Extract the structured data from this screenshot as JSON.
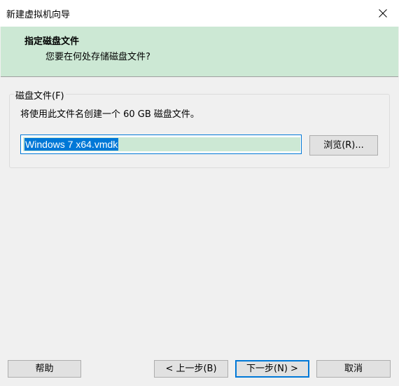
{
  "window": {
    "title": "新建虚拟机向导"
  },
  "header": {
    "title": "指定磁盘文件",
    "subtitle": "您要在何处存储磁盘文件?"
  },
  "disk_file": {
    "group_label": "磁盘文件(F)",
    "description": "将使用此文件名创建一个 60 GB 磁盘文件。",
    "filename": "Windows 7 x64.vmdk",
    "browse_label": "浏览(R)..."
  },
  "footer": {
    "help_label": "帮助",
    "back_label": "< 上一步(B)",
    "next_label": "下一步(N) >",
    "cancel_label": "取消"
  },
  "colors": {
    "header_bg": "#cce8d4",
    "focus_blue": "#0078d7",
    "button_bg": "#e1e1e1"
  }
}
